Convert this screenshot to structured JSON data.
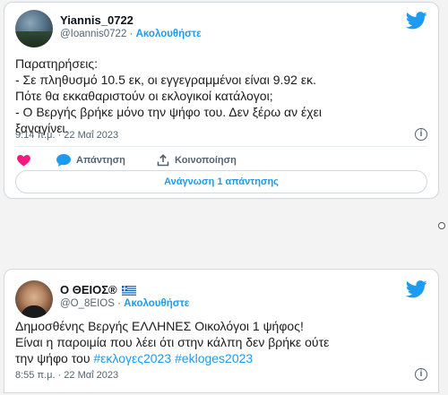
{
  "tweet1": {
    "display_name": "Yiannis_0722",
    "handle": "@Ioannis0722",
    "dot": "·",
    "follow_label": "Ακολουθήστε",
    "text": "Παρατηρήσεις:\n- Σε πληθυσμό 10.5 εκ, οι εγγεγραμμένοι είναι 9.92 εκ.\nΠότε θα εκκαθαριστούν οι εκλογικοί κατάλογοι;\n- Ο Βεργής βρήκε μόνο την ψήφο του. Δεν ξέρω αν έχει\nξαναγίνει.",
    "timestamp": "9:14 π.μ. · 22 Μαΐ 2023",
    "reply_label": "Απάντηση",
    "share_label": "Κοινοποίηση",
    "read_replies_label": "Ανάγνωση 1 απάντησης"
  },
  "tweet2": {
    "display_name": "Ο ΘΕΙΟΣ®",
    "handle": "@O_8EIOS",
    "dot": "·",
    "follow_label": "Ακολουθήστε",
    "text_part1": "Δημοσθένης Βεργής ΕΛΛΗΝΕΣ Οικολόγοι 1 ψήφος!\nΕίναι η παροιμία που λέει ότι στην κάλπη δεν βρήκε ούτε\nτην ψήφο του ",
    "hashtag1": "#εκλογες2023",
    "space": " ",
    "hashtag2": "#ekloges2023",
    "timestamp": "8:55 π.μ. · 22 Μαΐ 2023"
  },
  "colors": {
    "accent": "#1d9bf0",
    "like": "#f91880",
    "muted": "#536471"
  },
  "icons": {
    "brand": "twitter-bird-icon",
    "like": "heart-icon",
    "reply": "speech-bubble-icon",
    "share": "share-upload-icon",
    "info": "info-icon"
  }
}
